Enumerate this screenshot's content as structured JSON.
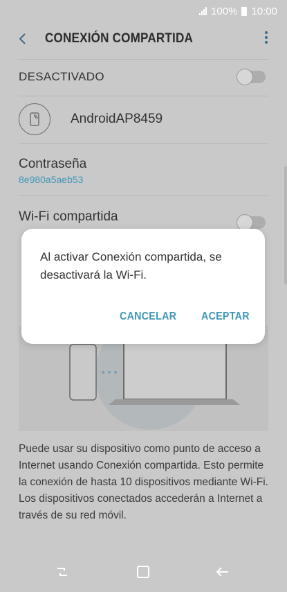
{
  "status_bar": {
    "battery": "100%",
    "time": "10:00"
  },
  "header": {
    "title": "CONEXIÓN COMPARTIDA"
  },
  "hotspot": {
    "state_label": "DESACTIVADO",
    "enabled": false
  },
  "network": {
    "name": "AndroidAP8459"
  },
  "password": {
    "label": "Contraseña",
    "value": "8e980a5aeb53"
  },
  "wifi_shared": {
    "label": "Wi-Fi compartida",
    "enabled": false
  },
  "description": "Puede usar su dispositivo como punto de acceso a Internet usando Conexión compartida. Esto permite la conexión de hasta 10 dispositivos mediante Wi-Fi. Los dispositivos conectados accederán a Internet a través de su red móvil.",
  "dialog": {
    "message": "Al activar Conexión compartida, se desactivará la Wi-Fi.",
    "cancel_label": "CANCELAR",
    "accept_label": "ACEPTAR"
  },
  "colors": {
    "accent": "#3f97b8",
    "scrim": "#c9c9c9"
  }
}
